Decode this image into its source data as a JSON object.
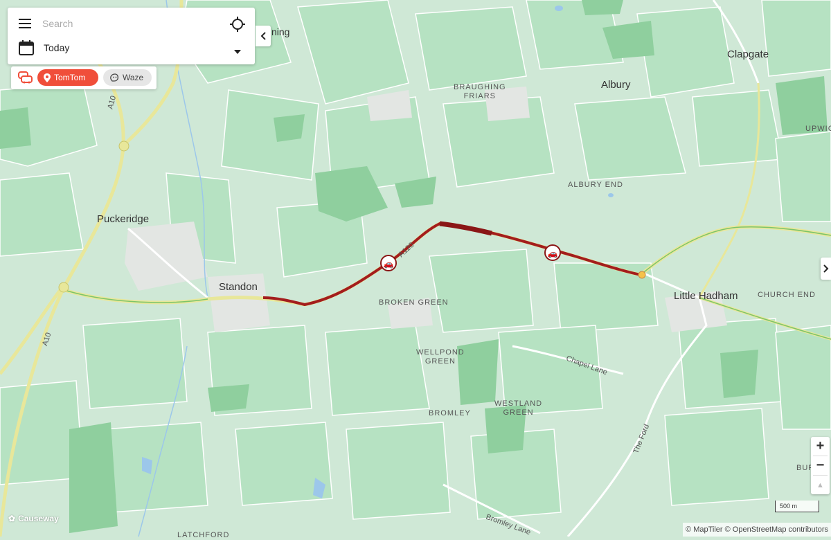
{
  "search": {
    "placeholder": "Search"
  },
  "date_filter": {
    "value": "Today"
  },
  "providers": {
    "tomtom_label": "TomTom",
    "waze_label": "Waze"
  },
  "places": {
    "clapgate": "Clapgate",
    "braughing_friars": "BRAUGHING\nFRIARS",
    "albury": "Albury",
    "upwick": "UPWIC",
    "albury_end": "ALBURY END",
    "puckeridge": "Puckeridge",
    "standon": "Standon",
    "little_hadham": "Little Hadham",
    "church_end": "CHURCH END",
    "broken_green": "BROKEN GREEN",
    "wellpond_green": "WELLPOND\nGREEN",
    "westland_green": "WESTLAND\nGREEN",
    "bromley": "BROMLEY",
    "latchford": "LATCHFORD",
    "braughing_partial": "ning",
    "bur_partial": "BUR"
  },
  "roads": {
    "a120": "A120",
    "a10_top": "A10",
    "a10_bottom": "A10",
    "chapel_lane": "Chapel Lane",
    "the_ford": "The Ford",
    "bromley_lane": "Bromley Lane"
  },
  "zoom": {
    "in": "+",
    "out": "−",
    "compass": "▲"
  },
  "scale": {
    "label": "500 m"
  },
  "attribution": "© MapTiler © OpenStreetMap contributors",
  "brand": {
    "name": "Causeway"
  },
  "colors": {
    "accent": "#f04e3a",
    "congestion": "#a31d1d",
    "road_major": "#e8e79a",
    "field_light": "#b6e2c2",
    "field_dark": "#8fcf9e",
    "urban": "#e3e6e3"
  }
}
